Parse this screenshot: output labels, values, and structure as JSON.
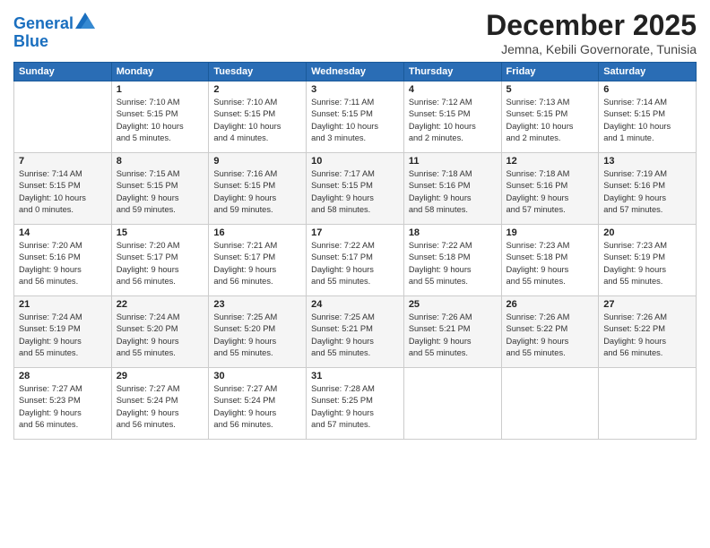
{
  "logo": {
    "line1": "General",
    "line2": "Blue"
  },
  "title": "December 2025",
  "subtitle": "Jemna, Kebili Governorate, Tunisia",
  "days_header": [
    "Sunday",
    "Monday",
    "Tuesday",
    "Wednesday",
    "Thursday",
    "Friday",
    "Saturday"
  ],
  "weeks": [
    [
      {
        "day": "",
        "info": ""
      },
      {
        "day": "1",
        "info": "Sunrise: 7:10 AM\nSunset: 5:15 PM\nDaylight: 10 hours\nand 5 minutes."
      },
      {
        "day": "2",
        "info": "Sunrise: 7:10 AM\nSunset: 5:15 PM\nDaylight: 10 hours\nand 4 minutes."
      },
      {
        "day": "3",
        "info": "Sunrise: 7:11 AM\nSunset: 5:15 PM\nDaylight: 10 hours\nand 3 minutes."
      },
      {
        "day": "4",
        "info": "Sunrise: 7:12 AM\nSunset: 5:15 PM\nDaylight: 10 hours\nand 2 minutes."
      },
      {
        "day": "5",
        "info": "Sunrise: 7:13 AM\nSunset: 5:15 PM\nDaylight: 10 hours\nand 2 minutes."
      },
      {
        "day": "6",
        "info": "Sunrise: 7:14 AM\nSunset: 5:15 PM\nDaylight: 10 hours\nand 1 minute."
      }
    ],
    [
      {
        "day": "7",
        "info": "Sunrise: 7:14 AM\nSunset: 5:15 PM\nDaylight: 10 hours\nand 0 minutes."
      },
      {
        "day": "8",
        "info": "Sunrise: 7:15 AM\nSunset: 5:15 PM\nDaylight: 9 hours\nand 59 minutes."
      },
      {
        "day": "9",
        "info": "Sunrise: 7:16 AM\nSunset: 5:15 PM\nDaylight: 9 hours\nand 59 minutes."
      },
      {
        "day": "10",
        "info": "Sunrise: 7:17 AM\nSunset: 5:15 PM\nDaylight: 9 hours\nand 58 minutes."
      },
      {
        "day": "11",
        "info": "Sunrise: 7:18 AM\nSunset: 5:16 PM\nDaylight: 9 hours\nand 58 minutes."
      },
      {
        "day": "12",
        "info": "Sunrise: 7:18 AM\nSunset: 5:16 PM\nDaylight: 9 hours\nand 57 minutes."
      },
      {
        "day": "13",
        "info": "Sunrise: 7:19 AM\nSunset: 5:16 PM\nDaylight: 9 hours\nand 57 minutes."
      }
    ],
    [
      {
        "day": "14",
        "info": "Sunrise: 7:20 AM\nSunset: 5:16 PM\nDaylight: 9 hours\nand 56 minutes."
      },
      {
        "day": "15",
        "info": "Sunrise: 7:20 AM\nSunset: 5:17 PM\nDaylight: 9 hours\nand 56 minutes."
      },
      {
        "day": "16",
        "info": "Sunrise: 7:21 AM\nSunset: 5:17 PM\nDaylight: 9 hours\nand 56 minutes."
      },
      {
        "day": "17",
        "info": "Sunrise: 7:22 AM\nSunset: 5:17 PM\nDaylight: 9 hours\nand 55 minutes."
      },
      {
        "day": "18",
        "info": "Sunrise: 7:22 AM\nSunset: 5:18 PM\nDaylight: 9 hours\nand 55 minutes."
      },
      {
        "day": "19",
        "info": "Sunrise: 7:23 AM\nSunset: 5:18 PM\nDaylight: 9 hours\nand 55 minutes."
      },
      {
        "day": "20",
        "info": "Sunrise: 7:23 AM\nSunset: 5:19 PM\nDaylight: 9 hours\nand 55 minutes."
      }
    ],
    [
      {
        "day": "21",
        "info": "Sunrise: 7:24 AM\nSunset: 5:19 PM\nDaylight: 9 hours\nand 55 minutes."
      },
      {
        "day": "22",
        "info": "Sunrise: 7:24 AM\nSunset: 5:20 PM\nDaylight: 9 hours\nand 55 minutes."
      },
      {
        "day": "23",
        "info": "Sunrise: 7:25 AM\nSunset: 5:20 PM\nDaylight: 9 hours\nand 55 minutes."
      },
      {
        "day": "24",
        "info": "Sunrise: 7:25 AM\nSunset: 5:21 PM\nDaylight: 9 hours\nand 55 minutes."
      },
      {
        "day": "25",
        "info": "Sunrise: 7:26 AM\nSunset: 5:21 PM\nDaylight: 9 hours\nand 55 minutes."
      },
      {
        "day": "26",
        "info": "Sunrise: 7:26 AM\nSunset: 5:22 PM\nDaylight: 9 hours\nand 55 minutes."
      },
      {
        "day": "27",
        "info": "Sunrise: 7:26 AM\nSunset: 5:22 PM\nDaylight: 9 hours\nand 56 minutes."
      }
    ],
    [
      {
        "day": "28",
        "info": "Sunrise: 7:27 AM\nSunset: 5:23 PM\nDaylight: 9 hours\nand 56 minutes."
      },
      {
        "day": "29",
        "info": "Sunrise: 7:27 AM\nSunset: 5:24 PM\nDaylight: 9 hours\nand 56 minutes."
      },
      {
        "day": "30",
        "info": "Sunrise: 7:27 AM\nSunset: 5:24 PM\nDaylight: 9 hours\nand 56 minutes."
      },
      {
        "day": "31",
        "info": "Sunrise: 7:28 AM\nSunset: 5:25 PM\nDaylight: 9 hours\nand 57 minutes."
      },
      {
        "day": "",
        "info": ""
      },
      {
        "day": "",
        "info": ""
      },
      {
        "day": "",
        "info": ""
      }
    ]
  ]
}
